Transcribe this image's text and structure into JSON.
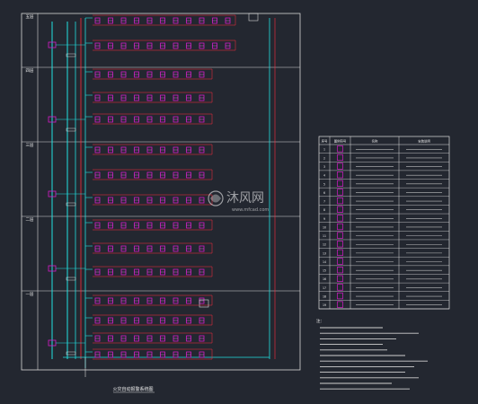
{
  "drawing": {
    "caption": "火灾自动报警系统图",
    "floors": [
      "五层",
      "四层",
      "三层",
      "二层",
      "一层"
    ],
    "watermark": {
      "brand": "沐风网",
      "url": "www.mfcad.com"
    }
  },
  "legend": {
    "headers": [
      "序号",
      "图例符号",
      "名称",
      "安装说明"
    ],
    "rows": [
      [
        "1",
        "",
        "",
        ""
      ],
      [
        "2",
        "",
        "",
        ""
      ],
      [
        "3",
        "",
        "",
        ""
      ],
      [
        "4",
        "",
        "",
        ""
      ],
      [
        "5",
        "",
        "",
        ""
      ],
      [
        "6",
        "",
        "",
        ""
      ],
      [
        "7",
        "",
        "",
        ""
      ],
      [
        "8",
        "",
        "",
        ""
      ],
      [
        "9",
        "",
        "",
        ""
      ],
      [
        "10",
        "",
        "",
        ""
      ],
      [
        "11",
        "",
        "",
        ""
      ],
      [
        "12",
        "",
        "",
        ""
      ],
      [
        "13",
        "",
        "",
        ""
      ],
      [
        "14",
        "",
        "",
        ""
      ],
      [
        "15",
        "",
        "",
        ""
      ],
      [
        "16",
        "",
        "",
        ""
      ],
      [
        "17",
        "",
        "",
        ""
      ],
      [
        "18",
        "",
        "",
        ""
      ],
      [
        "19",
        "",
        "",
        ""
      ]
    ]
  },
  "notes": {
    "title": "注：",
    "lines": [
      "",
      "",
      "",
      "",
      "",
      "",
      "",
      "",
      "",
      "",
      "",
      ""
    ]
  },
  "colors": {
    "background": "#232730",
    "frame": "#d8d8d8",
    "bus_red": "#ff2a3c",
    "bus_cyan": "#20e0e0",
    "device_magenta": "#d41cc8",
    "device_label": "#ff80ff"
  }
}
